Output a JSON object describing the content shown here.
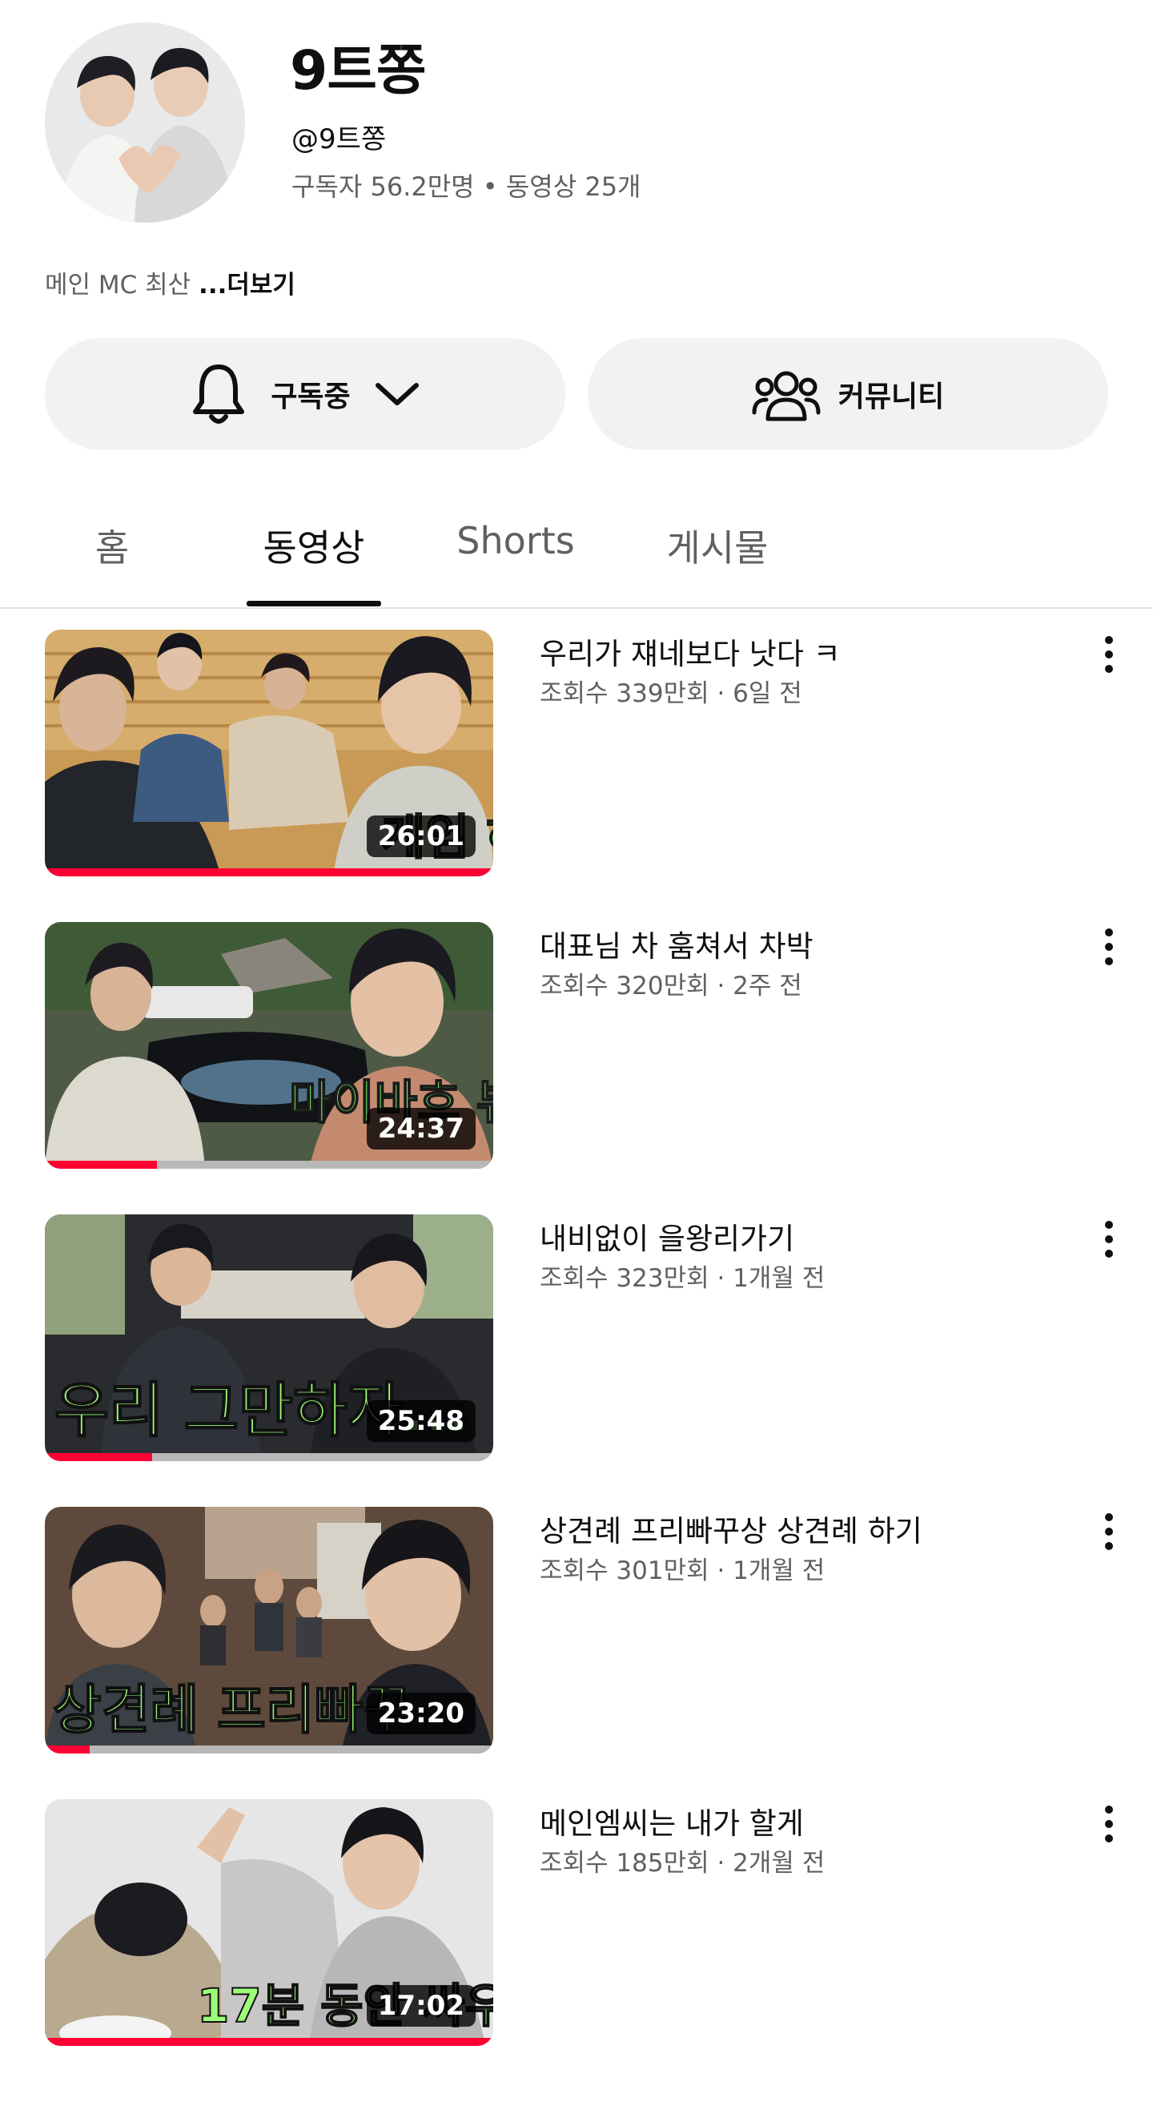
{
  "channel": {
    "name": "9트쫑",
    "handle": "@9트쫑",
    "stats": "구독자 56.2만명 • 동영상 25개",
    "description": "메인 MC 최산 ",
    "description_more": "...더보기"
  },
  "actions": {
    "subscribe_label": "구독중",
    "community_label": "커뮤니티"
  },
  "tabs": [
    {
      "label": "홈",
      "active": false
    },
    {
      "label": "동영상",
      "active": true
    },
    {
      "label": "Shorts",
      "active": false
    },
    {
      "label": "게시물",
      "active": false
    }
  ],
  "videos": [
    {
      "title": "우리가 쟤네보다 낫다 ㅋ",
      "meta": "조회수 339만회 · 6일 전",
      "duration": "26:01",
      "progress": 1.0
    },
    {
      "title": "대표님 차 훔쳐서 차박",
      "meta": "조회수 320만회 · 2주 전",
      "duration": "24:37",
      "progress": 0.25
    },
    {
      "title": "내비없이 을왕리가기",
      "meta": "조회수 323만회 · 1개월 전",
      "duration": "25:48",
      "progress": 0.24
    },
    {
      "title": "상견례 프리빠꾸상 상견례 하기",
      "meta": "조회수 301만회 · 1개월 전",
      "duration": "23:20",
      "progress": 0.1
    },
    {
      "title": "메인엠씨는 내가 할게",
      "meta": "조회수 185만회 · 2개월 전",
      "duration": "17:02",
      "progress": 1.0
    }
  ],
  "colors": {
    "progress": "#ff0033",
    "button_bg": "#f2f2f2",
    "secondary_text": "#606060"
  }
}
